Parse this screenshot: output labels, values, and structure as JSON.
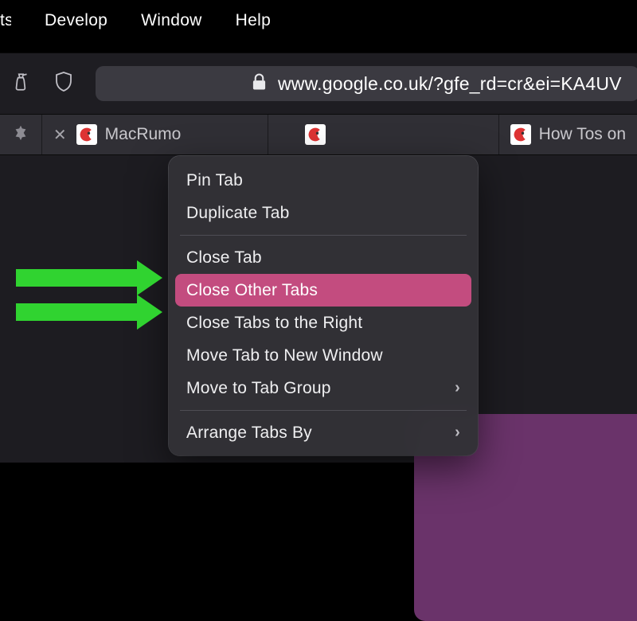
{
  "menubar": {
    "items": [
      "ts",
      "Develop",
      "Window",
      "Help"
    ]
  },
  "toolbar": {
    "url_domain": "www.google.co.uk",
    "url_path": "/?gfe_rd=cr&ei=KA4UV"
  },
  "tabs": {
    "pinned_label": "",
    "t1_label": "MacRumo",
    "t3_label": "How Tos on"
  },
  "context_menu": {
    "pin": "Pin Tab",
    "duplicate": "Duplicate Tab",
    "close": "Close Tab",
    "close_other": "Close Other Tabs",
    "close_right": "Close Tabs to the Right",
    "move_window": "Move Tab to New Window",
    "move_group": "Move to Tab Group",
    "arrange": "Arrange Tabs By"
  },
  "icons": {
    "spray": "spray-bottle-icon",
    "shield": "shield-icon",
    "lock": "lock-icon",
    "close": "close-icon",
    "chevron": "›"
  },
  "colors": {
    "highlight": "#c34c7f",
    "arrow": "#30d330"
  }
}
